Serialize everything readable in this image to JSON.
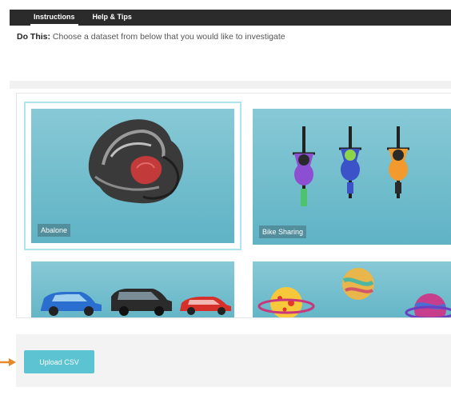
{
  "tabs": [
    {
      "label": "Instructions",
      "active": true
    },
    {
      "label": "Help & Tips",
      "active": false
    }
  ],
  "instruction": {
    "prefix": "Do This:",
    "text": "Choose a dataset from below that you would like to investigate"
  },
  "datasets": [
    {
      "label": "Abalone",
      "icon": "abalone-icon",
      "selected": true
    },
    {
      "label": "Bike Sharing",
      "icon": "cyclists-icon",
      "selected": false
    },
    {
      "label": "",
      "icon": "cars-icon",
      "selected": false
    },
    {
      "label": "",
      "icon": "planets-icon",
      "selected": false
    }
  ],
  "upload": {
    "label": "Upload CSV"
  },
  "colors": {
    "accent": "#5bc3d1",
    "card_bg": "#6bbccc",
    "arrow": "#e8882b",
    "topbar": "#2b2b2b"
  }
}
